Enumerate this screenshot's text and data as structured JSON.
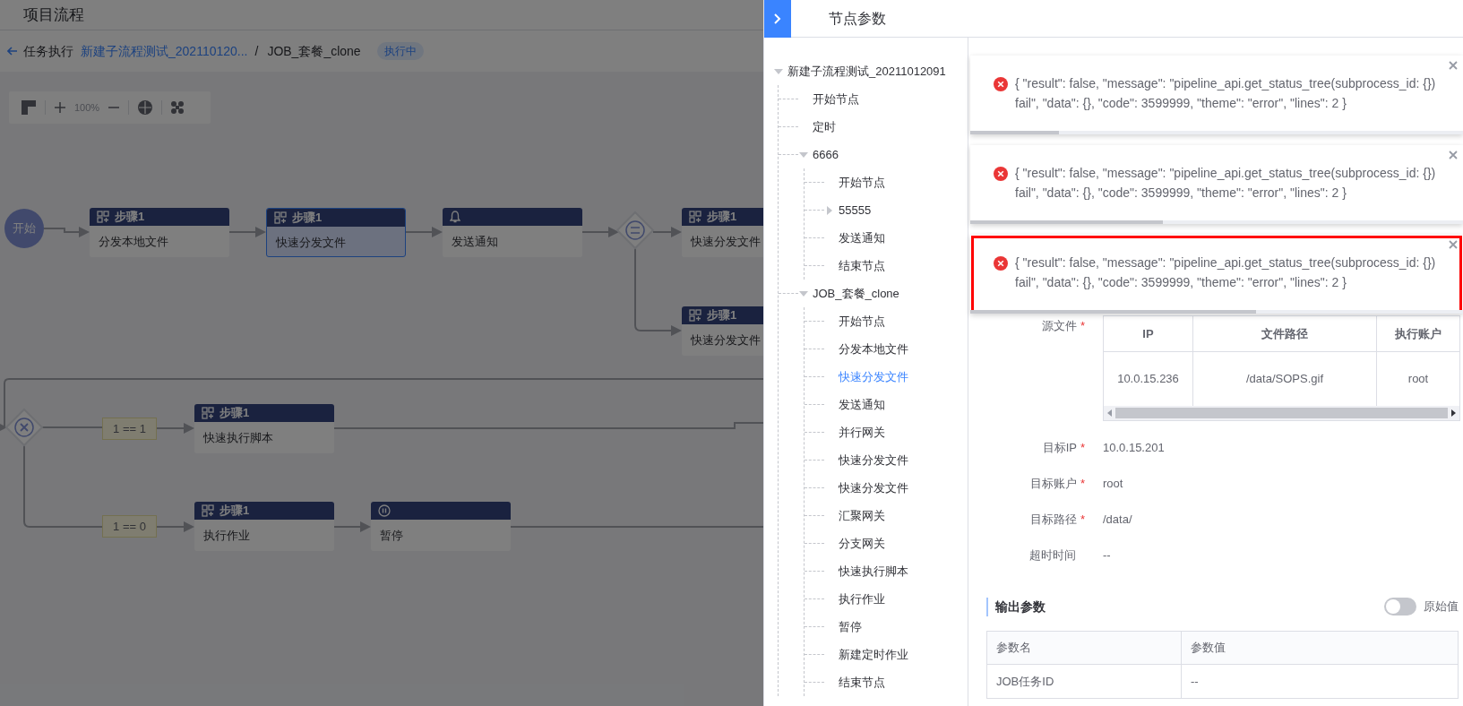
{
  "header": {
    "title": "项目流程"
  },
  "breadcrumb": {
    "back": "任务执行",
    "link": "新建子流程测试_202110120...",
    "separator": "/",
    "current": "JOB_套餐_clone",
    "status": "执行中"
  },
  "toolbar": {
    "zoom": "100%"
  },
  "canvas": {
    "start": "开始",
    "nodes": [
      {
        "kind": "task",
        "header": "步骤1",
        "label": "分发本地文件",
        "selected": false
      },
      {
        "kind": "task",
        "header": "步骤1",
        "label": "快速分发文件",
        "selected": true
      },
      {
        "kind": "notify",
        "label": "发送通知",
        "selected": false
      },
      {
        "kind": "task",
        "header": "步骤1",
        "label": "快速分发文件",
        "selected": false
      },
      {
        "kind": "task",
        "header": "步骤1",
        "label": "快速分发文件",
        "selected": false
      },
      {
        "kind": "task",
        "header": "步骤1",
        "label": "快速执行脚本",
        "selected": false
      },
      {
        "kind": "task",
        "header": "步骤1",
        "label": "执行作业",
        "selected": false
      },
      {
        "kind": "pause",
        "label": "暂停",
        "selected": false
      }
    ],
    "conditions": [
      "1 == 1",
      "1 == 0"
    ]
  },
  "panel": {
    "title": "节点参数",
    "tree": [
      {
        "label": "新建子流程测试_20211012091",
        "expanded": true,
        "selected": false,
        "children": [
          {
            "label": "开始节点",
            "selected": false
          },
          {
            "label": "定时",
            "selected": false
          },
          {
            "label": "6666",
            "expanded": true,
            "selected": false,
            "children": [
              {
                "label": "开始节点",
                "selected": false
              },
              {
                "label": "55555",
                "expanded": false,
                "selected": false
              },
              {
                "label": "发送通知",
                "selected": false
              },
              {
                "label": "结束节点",
                "selected": false
              }
            ]
          },
          {
            "label": "JOB_套餐_clone",
            "expanded": true,
            "selected": false,
            "children": [
              {
                "label": "开始节点",
                "selected": false
              },
              {
                "label": "分发本地文件",
                "selected": false
              },
              {
                "label": "快速分发文件",
                "selected": true
              },
              {
                "label": "发送通知",
                "selected": false
              },
              {
                "label": "并行网关",
                "selected": false
              },
              {
                "label": "快速分发文件",
                "selected": false
              },
              {
                "label": "快速分发文件",
                "selected": false
              },
              {
                "label": "汇聚网关",
                "selected": false
              },
              {
                "label": "分支网关",
                "selected": false
              },
              {
                "label": "快速执行脚本",
                "selected": false
              },
              {
                "label": "执行作业",
                "selected": false
              },
              {
                "label": "暂停",
                "selected": false
              },
              {
                "label": "新建定时作业",
                "selected": false
              },
              {
                "label": "结束节点",
                "selected": false
              }
            ]
          }
        ]
      }
    ],
    "toasts": [
      {
        "message": "{ \"result\": false, \"message\": \"pipeline_api.get_status_tree(subprocess_id: {}) fail\", \"data\": {}, \"code\": 3599999, \"theme\": \"error\", \"lines\": 2 }",
        "level": 0.18,
        "highlighted": false
      },
      {
        "message": "{ \"result\": false, \"message\": \"pipeline_api.get_status_tree(subprocess_id: {}) fail\", \"data\": {}, \"code\": 3599999, \"theme\": \"error\", \"lines\": 2 }",
        "level": 0.39,
        "highlighted": false
      },
      {
        "message": "{ \"result\": false, \"message\": \"pipeline_api.get_status_tree(subprocess_id: {}) fail\", \"data\": {}, \"code\": 3599999, \"theme\": \"error\", \"lines\": 2 }",
        "level": 0.58,
        "highlighted": true
      }
    ],
    "fields": [
      {
        "kind": "table",
        "label": "源文件",
        "required_mark": "*",
        "columns": [
          "IP",
          "文件路径",
          "执行账户"
        ],
        "rows": [
          [
            "10.0.15.236",
            "/data/SOPS.gif",
            "root"
          ]
        ]
      },
      {
        "kind": "text",
        "label": "目标IP",
        "required_mark": "*",
        "value": "10.0.15.201"
      },
      {
        "kind": "text",
        "label": "目标账户",
        "required_mark": "*",
        "value": "root"
      },
      {
        "kind": "text",
        "label": "目标路径",
        "required_mark": "*",
        "value": "/data/"
      },
      {
        "kind": "text",
        "label": "超时时间",
        "value": "--"
      }
    ],
    "output": {
      "title": "输出参数",
      "toggle": {
        "label": "原始值",
        "on": false
      },
      "columns": [
        "参数名",
        "参数值"
      ],
      "rows": [
        [
          "JOB任务ID",
          "--"
        ]
      ]
    }
  }
}
